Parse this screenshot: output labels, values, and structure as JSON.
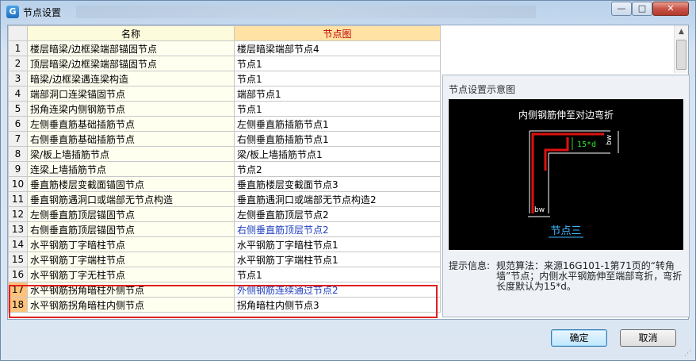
{
  "window": {
    "title": "节点设置"
  },
  "titlebar": {
    "min_glyph": "—",
    "max_glyph": "□",
    "close_glyph": "✕"
  },
  "table": {
    "headers": {
      "name": "名称",
      "node": "节点图"
    },
    "rows": [
      {
        "idx": "1",
        "name": "楼层暗梁/边框梁端部锚固节点",
        "node": "楼层暗梁端部节点4"
      },
      {
        "idx": "2",
        "name": "顶层暗梁/边框梁端部锚固节点",
        "node": "节点1"
      },
      {
        "idx": "3",
        "name": "暗梁/边框梁遇连梁构造",
        "node": "节点1"
      },
      {
        "idx": "4",
        "name": "端部洞口连梁锚固节点",
        "node": "端部节点1"
      },
      {
        "idx": "5",
        "name": "拐角连梁内侧钢筋节点",
        "node": "节点1"
      },
      {
        "idx": "6",
        "name": "左侧垂直筋基础插筋节点",
        "node": "左侧垂直筋插筋节点1"
      },
      {
        "idx": "7",
        "name": "右侧垂直筋基础插筋节点",
        "node": "右侧垂直筋插筋节点1"
      },
      {
        "idx": "8",
        "name": "梁/板上墙插筋节点",
        "node": "梁/板上墙插筋节点1"
      },
      {
        "idx": "9",
        "name": "连梁上墙插筋节点",
        "node": "节点2"
      },
      {
        "idx": "10",
        "name": "垂直筋楼层变截面锚固节点",
        "node": "垂直筋楼层变截面节点3"
      },
      {
        "idx": "11",
        "name": "垂直钢筋遇洞口或端部无节点构造",
        "node": "垂直筋遇洞口或端部无节点构造2"
      },
      {
        "idx": "12",
        "name": "左侧垂直筋顶层锚固节点",
        "node": "左侧垂直筋顶层节点2"
      },
      {
        "idx": "13",
        "name": "右侧垂直筋顶层锚固节点",
        "node": "右侧垂直筋顶层节点2"
      },
      {
        "idx": "14",
        "name": "水平钢筋丁字暗柱节点",
        "node": "水平钢筋丁字暗柱节点1"
      },
      {
        "idx": "15",
        "name": "水平钢筋丁字端柱节点",
        "node": "水平钢筋丁字端柱节点1"
      },
      {
        "idx": "16",
        "name": "水平钢筋丁字无柱节点",
        "node": "节点1"
      },
      {
        "idx": "17",
        "name": "水平钢筋拐角暗柱外侧节点",
        "node": "外侧钢筋连续通过节点2"
      },
      {
        "idx": "18",
        "name": "水平钢筋拐角暗柱内侧节点",
        "node": "拐角暗柱内侧节点3"
      }
    ]
  },
  "panel": {
    "title": "节点设置示意图",
    "diagram": {
      "caption": "内侧钢筋伸至对边弯折",
      "dim_label": "15*d",
      "bw_side": "bw",
      "bw_bottom": "bw",
      "node_name": "节点三"
    },
    "hint_label": "提示信息:",
    "hint_text": "规范算法：来源16G101-1第71页的“转角墙”节点；内侧水平钢筋伸至端部弯折，弯折长度默认为15*d。"
  },
  "buttons": {
    "ok": "确定",
    "cancel": "取消"
  },
  "colors": {
    "header_node_bg": "#ffe2a4",
    "header_node_text": "#c00000",
    "selected_index_bg": "#ffc27a",
    "highlight_border": "#e02020",
    "link_blue": "#1f3fbf"
  }
}
